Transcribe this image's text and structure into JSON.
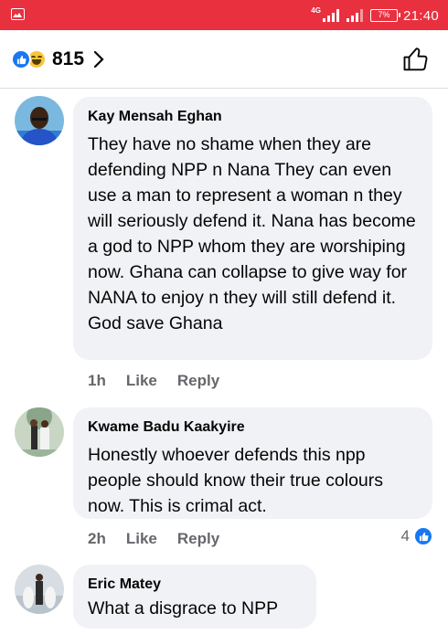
{
  "status_bar": {
    "network_label": "4G",
    "battery_text": "7%",
    "time": "21:40",
    "icons": [
      "gallery-icon",
      "signal-icon",
      "battery-icon"
    ],
    "accent_color": "#e8303f"
  },
  "header": {
    "reaction_icons": [
      "like-icon",
      "haha-icon"
    ],
    "reaction_count": "815",
    "like_button_icon": "thumbs-up-icon"
  },
  "comments": [
    {
      "author": "Kay Mensah Eghan",
      "text": "They have no shame when they are defending NPP n Nana They can even use a man to represent a woman n they will seriously defend it. Nana has become a god to NPP whom they are worshiping now. Ghana can collapse to give way for NANA to enjoy n they will still defend it. God save Ghana",
      "time": "1h",
      "like_label": "Like",
      "reply_label": "Reply",
      "reaction_count": ""
    },
    {
      "author": "Kwame Badu Kaakyire",
      "text": "Honestly whoever defends this npp people should know their true colours now. This is crimal act.",
      "time": "2h",
      "like_label": "Like",
      "reply_label": "Reply",
      "reaction_count": "4"
    },
    {
      "author": "Eric Matey",
      "text": "What a disgrace to NPP"
    }
  ],
  "colors": {
    "bubble": "#f0f2f5",
    "secondary_text": "#65676b",
    "like_blue": "#1877f2"
  }
}
